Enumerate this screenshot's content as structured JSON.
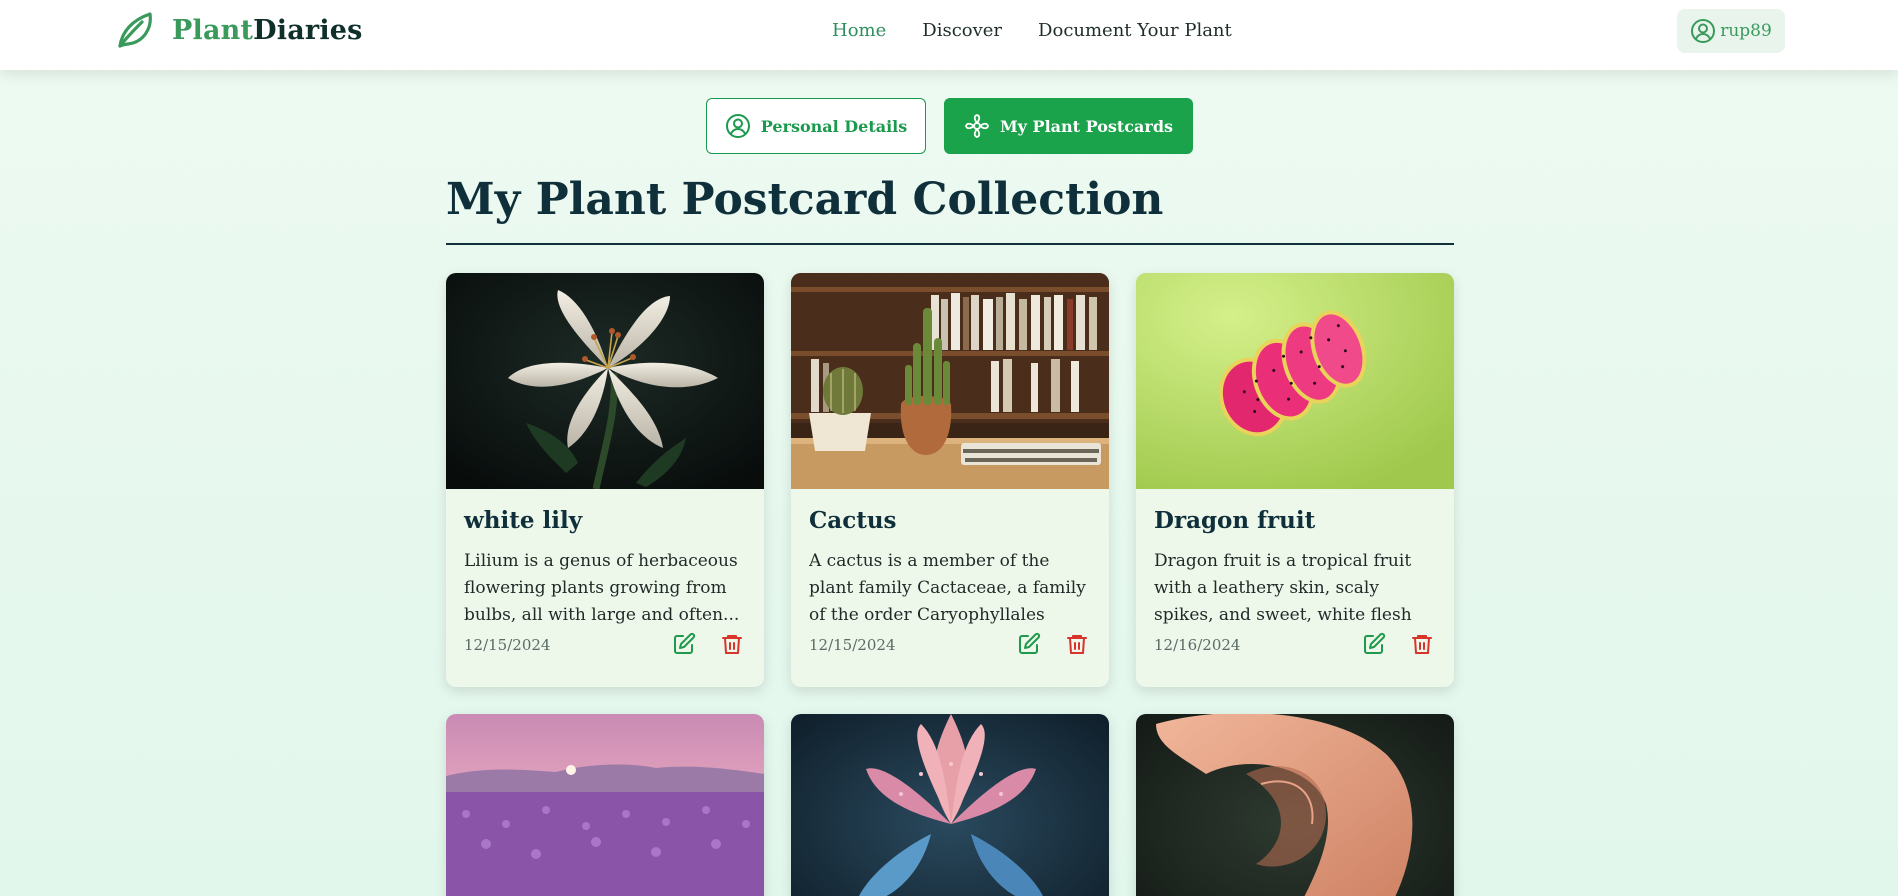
{
  "header": {
    "logo": {
      "part1": "Plant",
      "part2": "Diaries",
      "icon": "leaf-icon"
    },
    "nav": [
      {
        "label": "Home",
        "active": true
      },
      {
        "label": "Discover",
        "active": false
      },
      {
        "label": "Document Your Plant",
        "active": false
      }
    ],
    "user": {
      "username": "rup89",
      "icon": "user-circle-icon"
    }
  },
  "tabs": {
    "personal": {
      "label": "Personal Details",
      "icon": "user-circle-icon"
    },
    "postcards": {
      "label": "My Plant Postcards",
      "icon": "flower-icon"
    }
  },
  "page_title": "My Plant Postcard Collection",
  "cards": [
    {
      "title": "white lily",
      "description": "Lilium is a genus of herbaceous flowering plants growing from bulbs, all with large and often...",
      "date": "12/15/2024",
      "image": "white-lily-photo"
    },
    {
      "title": "Cactus",
      "description": "A cactus is a member of the plant family Cactaceae, a family of the order Caryophyllales comprising...",
      "date": "12/15/2024",
      "image": "cactus-photo"
    },
    {
      "title": "Dragon fruit",
      "description": "Dragon fruit is a tropical fruit with a leathery skin, scaly spikes, and sweet, white flesh with black seed...",
      "date": "12/16/2024",
      "image": "dragon-fruit-photo"
    },
    {
      "image": "lavender-field-photo"
    },
    {
      "image": "pink-flower-photo"
    },
    {
      "image": "calla-lily-photo"
    }
  ],
  "colors": {
    "brand_green": "#1aa34a",
    "logo_green": "#3a9a5c",
    "title_dark": "#0f2f3a",
    "delete_red": "#d9342b",
    "edit_green": "#1f9a4c"
  }
}
